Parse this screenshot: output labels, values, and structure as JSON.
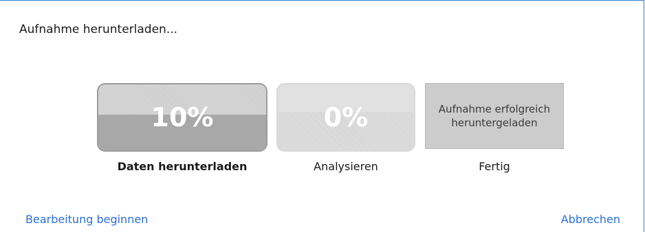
{
  "dialog": {
    "title": "Aufnahme herunterladen..."
  },
  "steps": [
    {
      "label": "Daten herunterladen",
      "percent_text": "10%",
      "progress": 0.1,
      "state": "active"
    },
    {
      "label": "Analysieren",
      "percent_text": "0%",
      "progress": 0.0,
      "state": "pending"
    },
    {
      "label": "Fertig",
      "message": "Aufnahme erfolgreich heruntergeladen",
      "state": "pending"
    }
  ],
  "actions": {
    "start_editing": "Bearbeitung beginnen",
    "cancel": "Abbrechen"
  },
  "colors": {
    "link": "#2a6fd0",
    "window_border": "#2c7fd6",
    "active_tile": "#a8a8a8",
    "inactive_tile": "#d5d5d5",
    "done_tile": "#cccccc"
  }
}
